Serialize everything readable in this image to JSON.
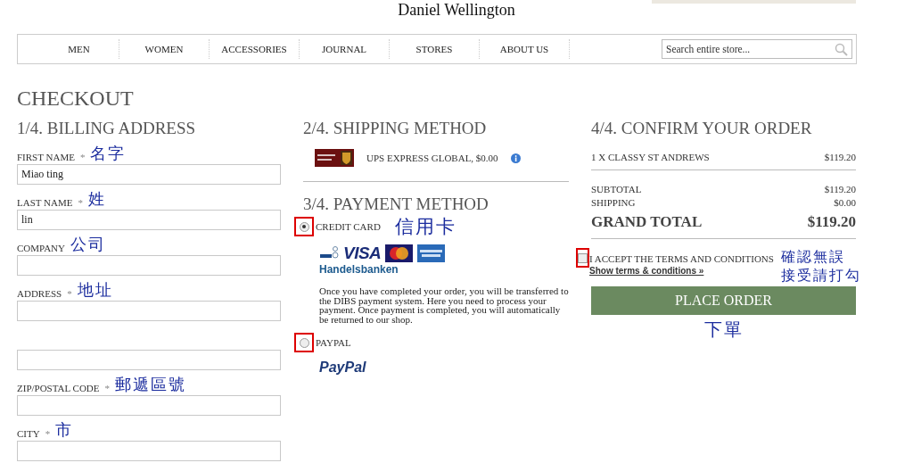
{
  "header": {
    "brand": "Daniel Wellington",
    "nav": [
      {
        "label": "MEN"
      },
      {
        "label": "WOMEN"
      },
      {
        "label": "ACCESSORIES"
      },
      {
        "label": "JOURNAL"
      },
      {
        "label": "STORES"
      },
      {
        "label": "ABOUT US"
      }
    ],
    "search": {
      "placeholder": "Search entire store..."
    }
  },
  "page_title": "CHECKOUT",
  "billing": {
    "heading": "1/4. BILLING ADDRESS",
    "fields": [
      {
        "label": "FIRST NAME",
        "marker": "*",
        "note": "名字",
        "value": "Miao ting"
      },
      {
        "label": "LAST NAME",
        "marker": "*",
        "note": "姓",
        "value": "lin"
      },
      {
        "label": "COMPANY",
        "note": "公司"
      },
      {
        "label": "ADDRESS",
        "marker": "*",
        "note": "地址"
      },
      {
        "kind": "continuation"
      },
      {
        "label": "ZIP/POSTAL CODE",
        "marker": "*",
        "note": "郵遞區號"
      },
      {
        "label": "CITY",
        "marker": "*",
        "note": "市"
      }
    ]
  },
  "shipping": {
    "heading": "2/4. SHIPPING METHOD",
    "option": "UPS EXPRESS GLOBAL, $0.00"
  },
  "payment": {
    "heading": "3/4. PAYMENT METHOD",
    "methods": [
      {
        "kind": "card",
        "label": "CREDIT CARD",
        "selected": true,
        "note": "信用卡",
        "logo_text": "VISA",
        "bank": "Handelsbanken",
        "description": "Once you have completed your order, you will be transferred to the DIBS payment system. Here you need to process your payment. Once payment is completed, you will automatically be returned to our shop."
      },
      {
        "kind": "paypal",
        "label": "PAYPAL",
        "selected": false,
        "logo_text": "PayPal"
      }
    ]
  },
  "confirm": {
    "heading": "4/4. CONFIRM YOUR ORDER",
    "items": [
      {
        "name": "1 X CLASSY ST ANDREWS",
        "price": "$119.20"
      }
    ],
    "totals": [
      {
        "label": "SUBTOTAL",
        "value": "$119.20"
      },
      {
        "label": "SHIPPING",
        "value": "$0.00"
      }
    ],
    "grand_total": {
      "label": "GRAND TOTAL",
      "value": "$119.20"
    },
    "terms": {
      "label": "I ACCEPT THE TERMS AND CONDITIONS",
      "checked": false,
      "link": "Show terms & conditions »",
      "notes": [
        "確認無誤",
        "接受請打勾"
      ]
    },
    "button": "PLACE ORDER",
    "button_note": "下單"
  }
}
